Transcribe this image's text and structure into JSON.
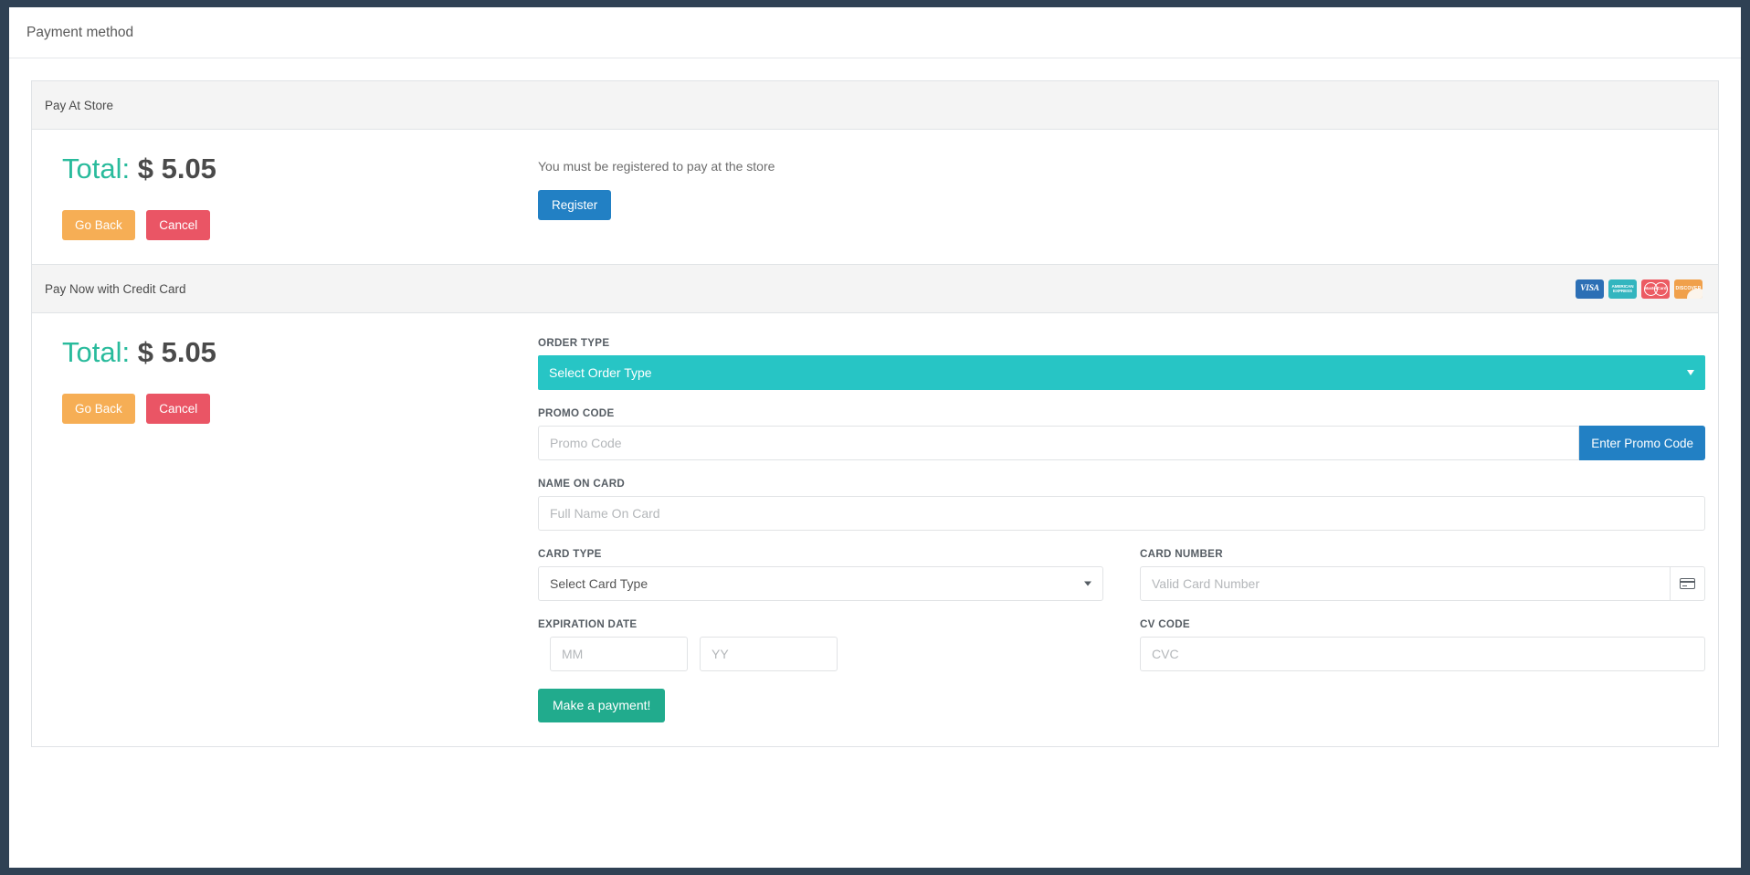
{
  "header": {
    "title": "Payment method"
  },
  "panel_store": {
    "heading": "Pay At Store",
    "total_label": "Total:",
    "total_amount": "$ 5.05",
    "go_back_label": "Go Back",
    "cancel_label": "Cancel",
    "note": "You must be registered to pay at the store",
    "register_label": "Register"
  },
  "panel_card": {
    "heading": "Pay Now with Credit Card",
    "total_label": "Total:",
    "total_amount": "$ 5.05",
    "go_back_label": "Go Back",
    "cancel_label": "Cancel",
    "card_logos": [
      {
        "name": "visa-logo",
        "text": "VISA"
      },
      {
        "name": "amex-logo",
        "text": "AMERICAN EXPRESS"
      },
      {
        "name": "mastercard-logo",
        "text": "MasterCard"
      },
      {
        "name": "discover-logo",
        "text": "DISCOVER"
      }
    ],
    "fields": {
      "order_type_label": "ORDER TYPE",
      "order_type_value": "Select Order Type",
      "promo_code_label": "PROMO CODE",
      "promo_code_value": "",
      "promo_code_placeholder": "Promo Code",
      "promo_button_label": "Enter Promo Code",
      "name_on_card_label": "NAME ON CARD",
      "name_on_card_value": "",
      "name_on_card_placeholder": "Full Name On Card",
      "card_type_label": "CARD TYPE",
      "card_type_value": "Select Card Type",
      "card_number_label": "CARD NUMBER",
      "card_number_value": "",
      "card_number_placeholder": "Valid Card Number",
      "expiration_label": "EXPIRATION DATE",
      "exp_month_value": "",
      "exp_month_placeholder": "MM",
      "exp_year_value": "",
      "exp_year_placeholder": "YY",
      "cv_code_label": "CV CODE",
      "cv_code_value": "",
      "cv_code_placeholder": "CVC"
    },
    "submit_label": "Make a payment!"
  },
  "colors": {
    "page_background": "#2f4154",
    "teal": "#27c5c5",
    "total_green": "#29bb9c",
    "blue": "#2280c4",
    "orange": "#f6ae55",
    "red": "#ea5565",
    "green": "#21ab8d"
  }
}
